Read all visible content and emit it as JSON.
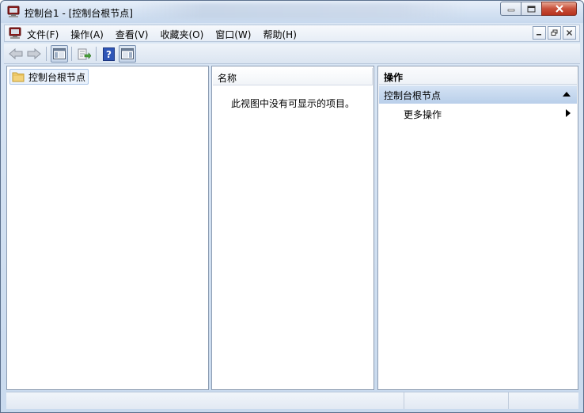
{
  "window": {
    "title": "控制台1 - [控制台根节点]"
  },
  "menubar": {
    "items": [
      {
        "label": "文件(F)"
      },
      {
        "label": "操作(A)"
      },
      {
        "label": "查看(V)"
      },
      {
        "label": "收藏夹(O)"
      },
      {
        "label": "窗口(W)"
      },
      {
        "label": "帮助(H)"
      }
    ]
  },
  "tree": {
    "root_label": "控制台根节点"
  },
  "list": {
    "column_header": "名称",
    "empty_message": "此视图中没有可显示的项目。"
  },
  "actions": {
    "header": "操作",
    "group_label": "控制台根节点",
    "more_label": "更多操作"
  },
  "icons": {
    "back": "back-arrow-icon",
    "forward": "forward-arrow-icon",
    "show-hide-tree": "console-tree-toggle-icon",
    "export": "export-list-icon",
    "help": "help-icon",
    "show-hide-actions": "action-pane-toggle-icon"
  },
  "colors": {
    "accent": "#c9daee",
    "selection": "#eaf2fc",
    "group_header": "#b9cfea",
    "close_button": "#c8503a"
  }
}
